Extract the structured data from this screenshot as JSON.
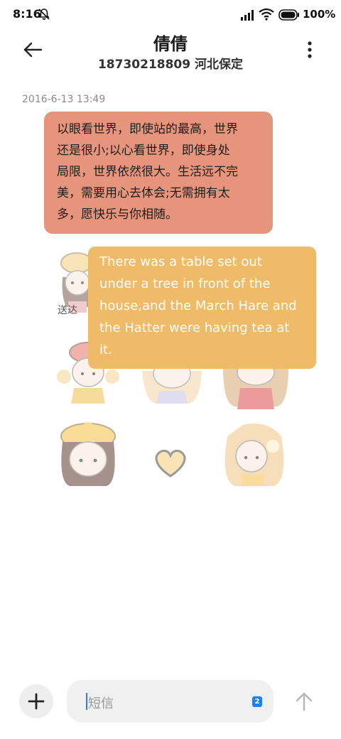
{
  "status_bar": {
    "time": "8:16",
    "battery": "100%"
  },
  "header": {
    "contact_name": "倩倩",
    "contact_detail": "18730218809 河北保定"
  },
  "conversation": {
    "timestamp": "2016-6-13 13:49",
    "messages": [
      {
        "lines": [
          "以眼看世界，即使站的最高，世界",
          "还是很小;以心看世界，即使身处",
          "局限，世界依然很大。生活远不完",
          "美，需要用心去体会;无需拥有太",
          "多，愿快乐与你相随。"
        ],
        "color": "#e6957c"
      },
      {
        "lines": [
          "There was a table set out",
          "under a tree in front of the",
          "house,and the March Hare and",
          "the Hatter were having tea at",
          "it."
        ],
        "color": "#efbb69"
      }
    ],
    "status_label": "送达"
  },
  "input_bar": {
    "placeholder": "短信",
    "sim_label": "2"
  },
  "icons": [
    "bell-off-icon",
    "signal-icon",
    "wifi-icon",
    "battery-icon",
    "back-arrow-icon",
    "more-vertical-icon",
    "plus-icon",
    "sim-card-icon",
    "send-arrow-icon",
    "heart-icon"
  ]
}
